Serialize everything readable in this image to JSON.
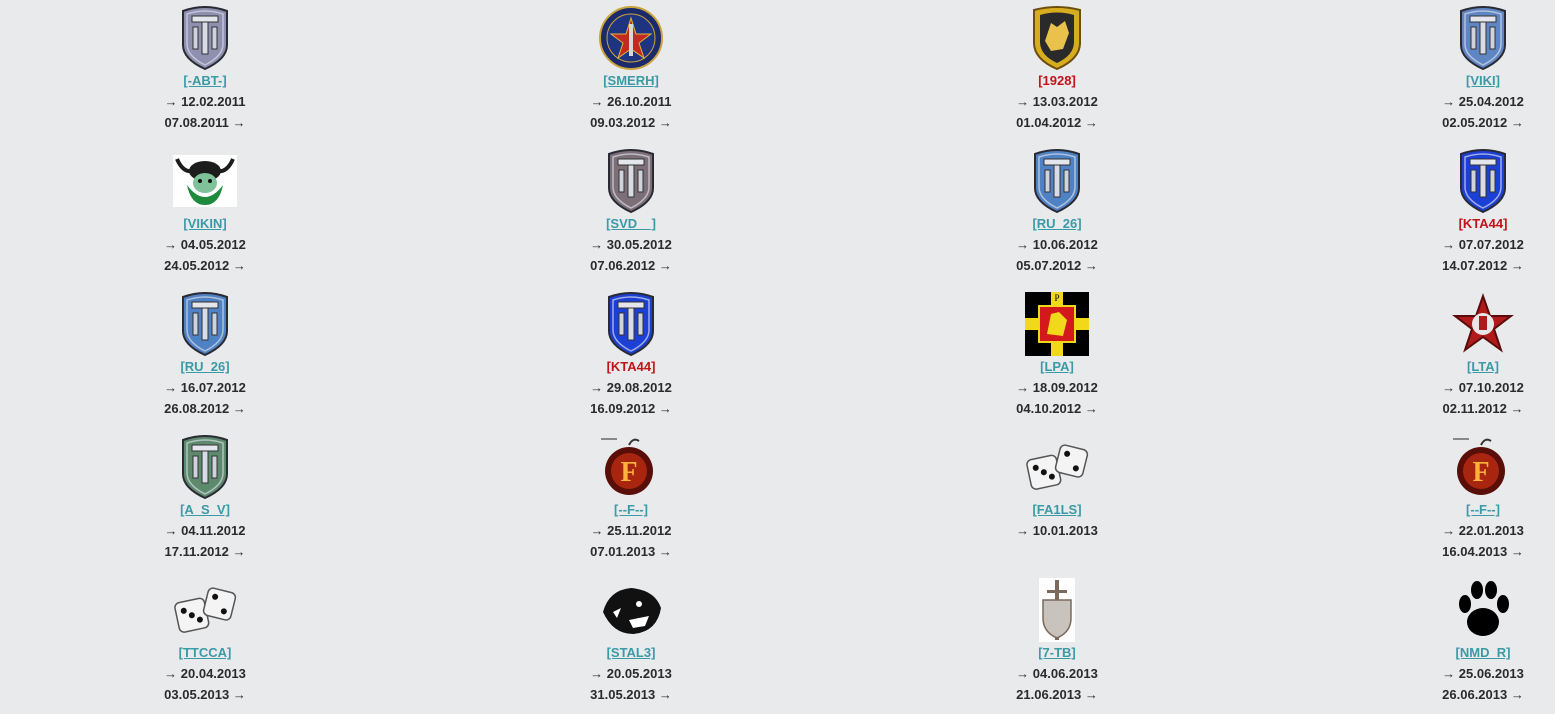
{
  "arrow": "→",
  "colors": {
    "background": "#e9eaec",
    "tag_link": "#3a9aa6",
    "tag_highlight": "#c0131a",
    "date_text": "#2b2b2b"
  },
  "clans": [
    {
      "tag": "[-ABT-]",
      "start": "→ 12.02.2011",
      "end": "07.08.2011 →",
      "icon": "wot-shield-icon",
      "shade": "#8f8fb0",
      "highlight": false
    },
    {
      "tag": "[SMERH]",
      "start": "→ 26.10.2011",
      "end": "09.03.2012 →",
      "icon": "smersh-round-emblem-icon",
      "shade": "#1b2a6b",
      "highlight": false
    },
    {
      "tag": "[1928]",
      "start": "→ 13.03.2012",
      "end": "01.04.2012 →",
      "icon": "gold-shield-wolf-icon",
      "shade": "#d8ac1f",
      "highlight": true
    },
    {
      "tag": "[VIKI]",
      "start": "→ 25.04.2012",
      "end": "02.05.2012 →",
      "icon": "wot-shield-icon",
      "shade": "#5f86c4",
      "highlight": false
    },
    {
      "tag": "[VIKIN]",
      "start": "→ 04.05.2012",
      "end": "24.05.2012 →",
      "icon": "green-viking-head-icon",
      "shade": "#1e8a3c",
      "highlight": false
    },
    {
      "tag": "[SVD__]",
      "start": "→ 30.05.2012",
      "end": "07.06.2012 →",
      "icon": "wot-shield-icon",
      "shade": "#7d6f78",
      "highlight": false
    },
    {
      "tag": "[RU_26]",
      "start": "→ 10.06.2012",
      "end": "05.07.2012 →",
      "icon": "wot-shield-icon",
      "shade": "#4f82c4",
      "highlight": false
    },
    {
      "tag": "[KTA44]",
      "start": "→ 07.07.2012",
      "end": "14.07.2012 →",
      "icon": "wot-shield-icon",
      "shade": "#1c3fd6",
      "highlight": true
    },
    {
      "tag": "[RU_26]",
      "start": "→ 16.07.2012",
      "end": "26.08.2012 →",
      "icon": "wot-shield-icon",
      "shade": "#4f82c4",
      "highlight": false
    },
    {
      "tag": "[KTA44]",
      "start": "→ 29.08.2012",
      "end": "16.09.2012 →",
      "icon": "wot-shield-icon",
      "shade": "#1c3fd6",
      "highlight": true
    },
    {
      "tag": "[LPA]",
      "start": "→ 18.09.2012",
      "end": "04.10.2012 →",
      "icon": "black-cross-lion-flag-icon",
      "shade": "#f2d81a",
      "highlight": false
    },
    {
      "tag": "[LTA]",
      "start": "→ 07.10.2012",
      "end": "02.11.2012 →",
      "icon": "red-star-fist-icon",
      "shade": "#b01a1a",
      "highlight": false
    },
    {
      "tag": "[A_S_V]",
      "start": "→ 04.11.2012",
      "end": "17.11.2012 →",
      "icon": "wot-shield-icon",
      "shade": "#5d8a6c",
      "highlight": false
    },
    {
      "tag": "[--F--]",
      "start": "→ 25.11.2012",
      "end": "07.01.2013 →",
      "icon": "bomb-f-icon",
      "shade": "#8a1a10",
      "highlight": false
    },
    {
      "tag": "[FA1LS]",
      "start": "→ 10.01.2013",
      "end": "",
      "icon": "dice-icon",
      "shade": "#ffffff",
      "highlight": false
    },
    {
      "tag": "[--F--]",
      "start": "→ 22.01.2013",
      "end": "16.04.2013 →",
      "icon": "bomb-f-icon",
      "shade": "#8a1a10",
      "highlight": false
    },
    {
      "tag": "[TTCCA]",
      "start": "→ 20.04.2013",
      "end": "03.05.2013 →",
      "icon": "dice-icon",
      "shade": "#ffffff",
      "highlight": false
    },
    {
      "tag": "[STAL3]",
      "start": "→ 20.05.2013",
      "end": "31.05.2013 →",
      "icon": "panther-head-icon",
      "shade": "#111111",
      "highlight": false
    },
    {
      "tag": "[7-TB]",
      "start": "→ 04.06.2013",
      "end": "21.06.2013 →",
      "icon": "sword-shield-icon",
      "shade": "#9a8f86",
      "highlight": false
    },
    {
      "tag": "[NMD_R]",
      "start": "→ 25.06.2013",
      "end": "26.06.2013 →",
      "icon": "paw-print-icon",
      "shade": "#000000",
      "highlight": false
    }
  ]
}
